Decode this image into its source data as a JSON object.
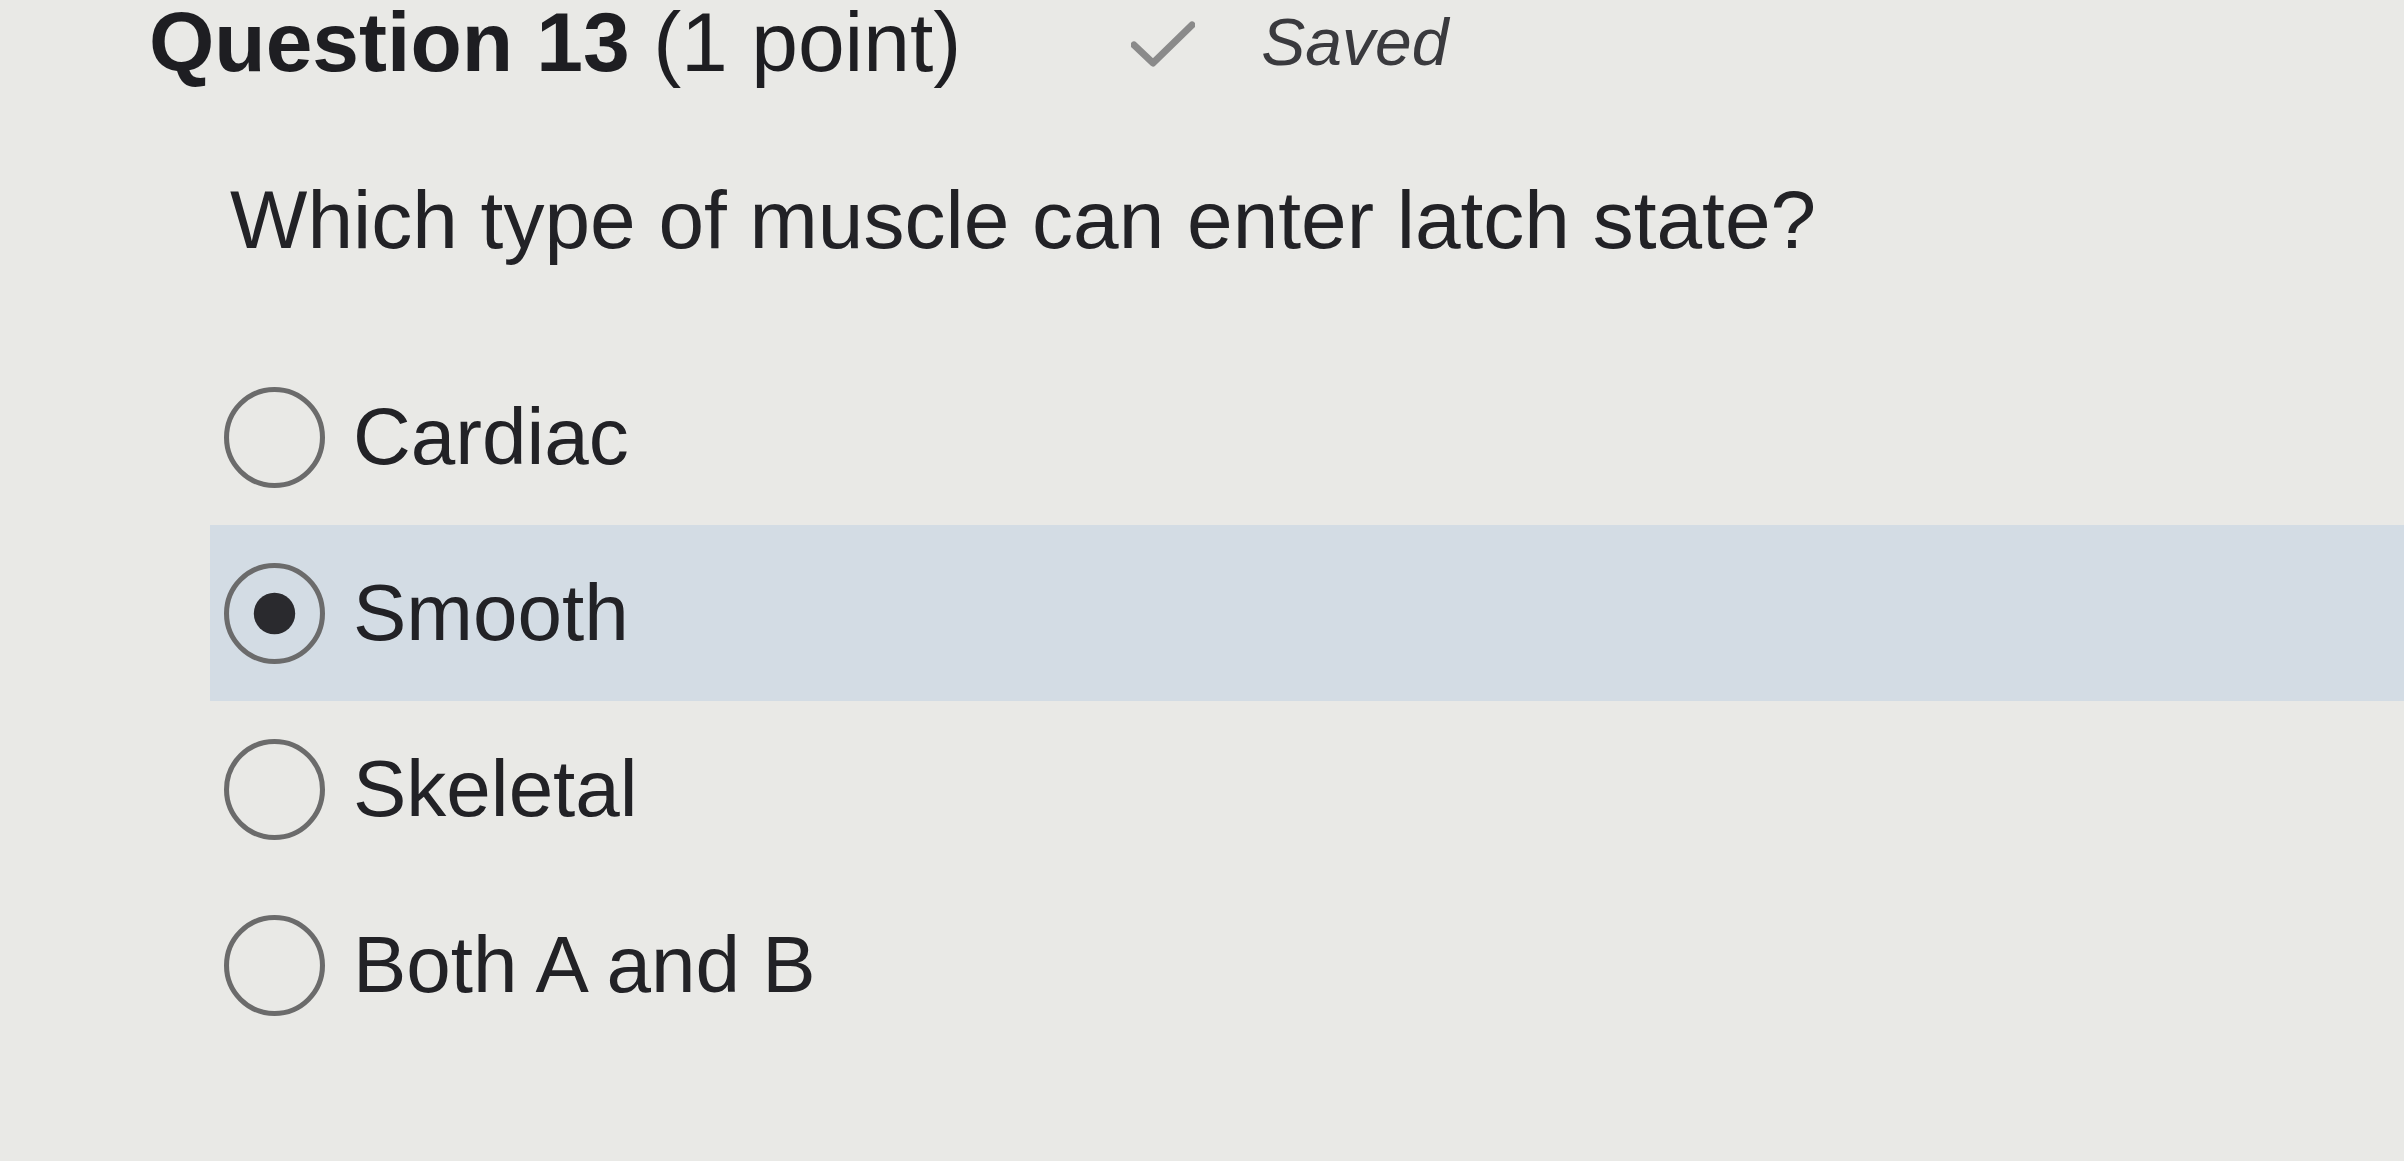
{
  "header": {
    "title": "**Question 13** (1 point)",
    "status": "Saved"
  },
  "question": "Which type of muscle can enter latch state?",
  "options": [
    {
      "label": "Cardiac",
      "selected": false
    },
    {
      "label": "Smooth",
      "selected": true
    },
    {
      "label": "Skeletal",
      "selected": false
    },
    {
      "label": "Both A and B",
      "selected": false
    }
  ]
}
